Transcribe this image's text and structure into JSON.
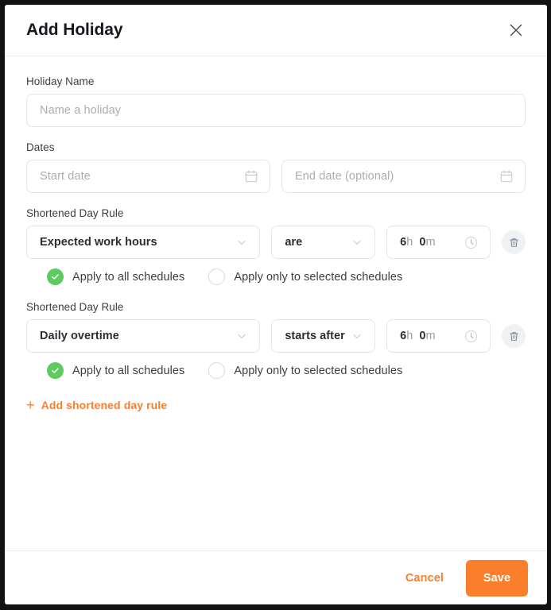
{
  "dialog": {
    "title": "Add Holiday",
    "close_icon": "close-icon"
  },
  "form": {
    "holiday_name": {
      "label": "Holiday Name",
      "placeholder": "Name a holiday",
      "value": ""
    },
    "dates": {
      "label": "Dates",
      "start": {
        "placeholder": "Start date",
        "value": "",
        "icon": "calendar-icon"
      },
      "end": {
        "placeholder": "End date (optional)",
        "value": "",
        "icon": "calendar-icon"
      }
    },
    "rules": [
      {
        "label": "Shortened Day Rule",
        "type_value": "Expected work hours",
        "operator_value": "are",
        "time": {
          "hours": "6",
          "hours_unit": "h",
          "minutes": "0",
          "minutes_unit": "m"
        },
        "clock_icon": "clock-icon",
        "delete_icon": "trash-icon",
        "options": {
          "all": {
            "label": "Apply to all schedules",
            "selected": true
          },
          "selected": {
            "label": "Apply only to selected schedules",
            "selected": false
          }
        }
      },
      {
        "label": "Shortened Day Rule",
        "type_value": "Daily overtime",
        "operator_value": "starts after",
        "time": {
          "hours": "6",
          "hours_unit": "h",
          "minutes": "0",
          "minutes_unit": "m"
        },
        "clock_icon": "clock-icon",
        "delete_icon": "trash-icon",
        "options": {
          "all": {
            "label": "Apply to all schedules",
            "selected": true
          },
          "selected": {
            "label": "Apply only to selected schedules",
            "selected": false
          }
        }
      }
    ],
    "add_rule_link": {
      "label": "Add shortened day rule",
      "icon": "plus-icon"
    }
  },
  "footer": {
    "cancel_label": "Cancel",
    "save_label": "Save"
  },
  "colors": {
    "accent_orange": "#FB7E2C",
    "radio_green": "#5ECB5E",
    "border_gray": "#E2E4E7",
    "text_dark": "#16191D"
  }
}
